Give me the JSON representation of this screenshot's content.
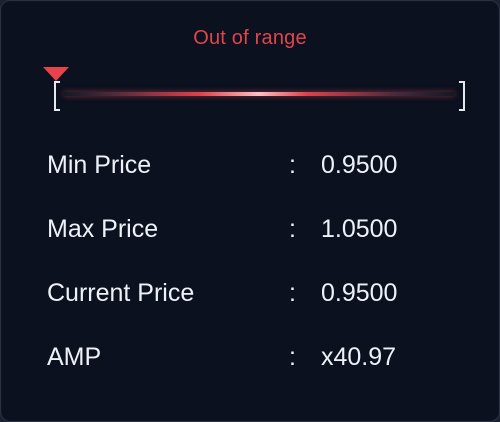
{
  "status": {
    "text": "Out of range",
    "color": "#e0454c"
  },
  "range_bar": {
    "marker_icon": "triangle-down-marker",
    "left_bracket": "[",
    "right_bracket": "]"
  },
  "rows": [
    {
      "label": "Min Price",
      "separator": ":",
      "value": "0.9500"
    },
    {
      "label": "Max Price",
      "separator": ":",
      "value": "1.0500"
    },
    {
      "label": "Current Price",
      "separator": ":",
      "value": "0.9500"
    },
    {
      "label": "AMP",
      "separator": ":",
      "value": "x40.97"
    }
  ]
}
